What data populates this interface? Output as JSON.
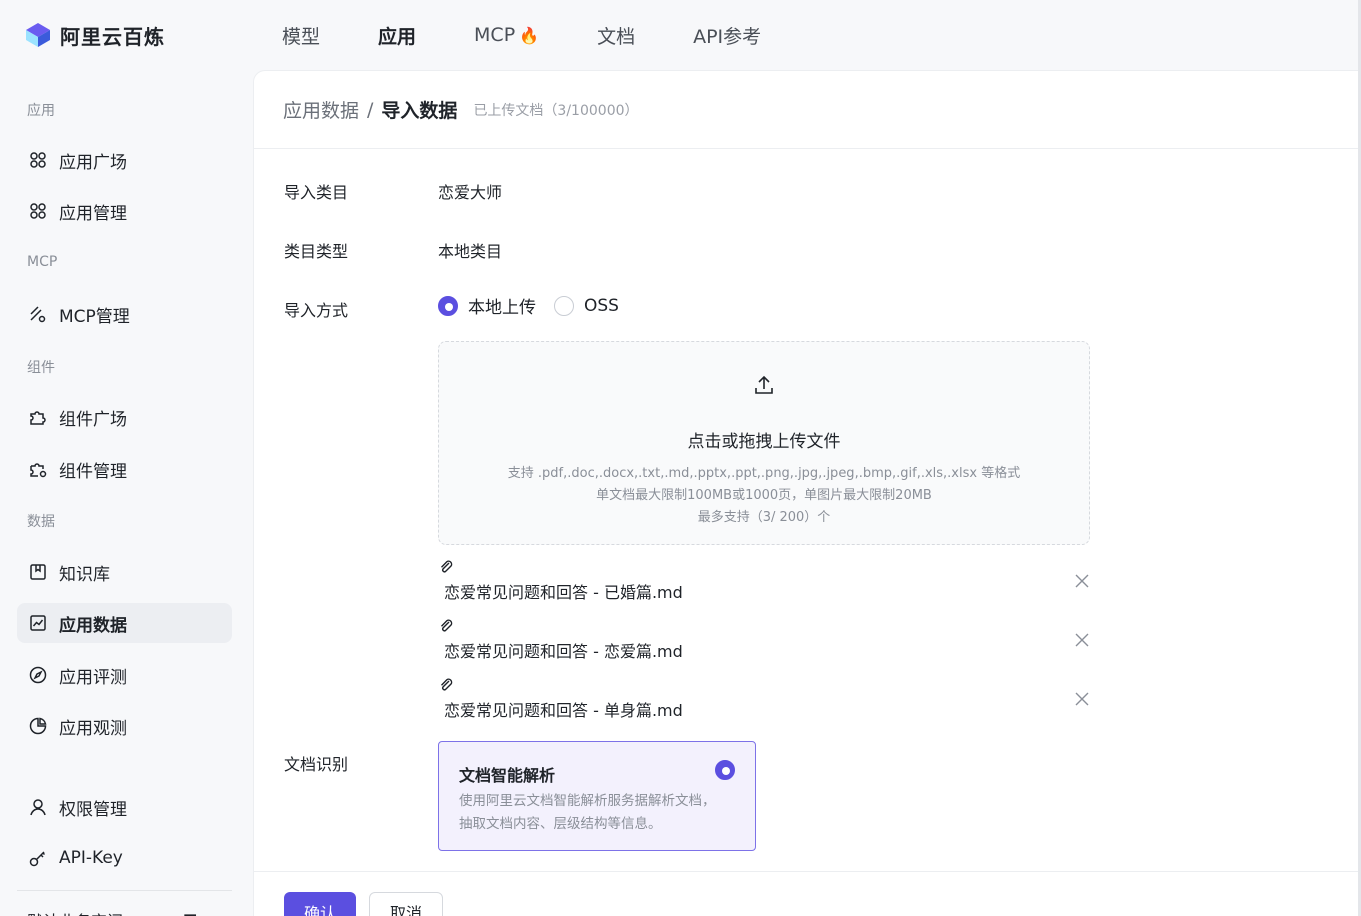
{
  "brand": {
    "name": "阿里云百炼"
  },
  "topnav": [
    {
      "label": "模型"
    },
    {
      "label": "应用"
    },
    {
      "label": "MCP"
    },
    {
      "label": "文档"
    },
    {
      "label": "API参考"
    }
  ],
  "sidebar": {
    "sections": [
      "应用",
      "MCP",
      "组件",
      "数据"
    ],
    "items": [
      {
        "label": "应用广场",
        "icon": "app-grid-icon"
      },
      {
        "label": "应用管理",
        "icon": "app-grid-icon"
      },
      {
        "label": "MCP管理",
        "icon": "mcp-icon"
      },
      {
        "label": "组件广场",
        "icon": "puzzle-icon"
      },
      {
        "label": "组件管理",
        "icon": "puzzle-gear-icon"
      },
      {
        "label": "知识库",
        "icon": "bookmark-icon"
      },
      {
        "label": "应用数据",
        "icon": "chart-line-icon"
      },
      {
        "label": "应用评测",
        "icon": "compass-icon"
      },
      {
        "label": "应用观测",
        "icon": "pie-icon"
      },
      {
        "label": "权限管理",
        "icon": "user-icon"
      },
      {
        "label": "API-Key",
        "icon": "key-icon"
      }
    ],
    "bottom_label": "默认业务空间"
  },
  "header": {
    "crumb_parent": "应用数据",
    "crumb_separator": "/",
    "crumb_current": "导入数据",
    "note": "已上传文档（3/100000）"
  },
  "form": {
    "category_label": "导入类目",
    "category_value": "恋爱大师",
    "type_label": "类目类型",
    "type_value": "本地类目",
    "method_label": "导入方式",
    "method_options": [
      "本地上传",
      "OSS"
    ],
    "method_selected": "本地上传",
    "recognize_label": "文档识别"
  },
  "upload": {
    "title": "点击或拖拽上传文件",
    "formats": "支持 .pdf,.doc,.docx,.txt,.md,.pptx,.ppt,.png,.jpg,.jpeg,.bmp,.gif,.xls,.xlsx 等格式",
    "limit": "单文档最大限制100MB或1000页，单图片最大限制20MB",
    "count": "最多支持（3/ 200）个"
  },
  "files": [
    {
      "name": "恋爱常见问题和回答 - 已婚篇.md"
    },
    {
      "name": "恋爱常见问题和回答 - 恋爱篇.md"
    },
    {
      "name": "恋爱常见问题和回答 - 单身篇.md"
    }
  ],
  "option": {
    "title": "文档智能解析",
    "desc": "使用阿里云文档智能解析服务据解析文档，抽取文档内容、层级结构等信息。"
  },
  "actions": {
    "confirm": "确认",
    "cancel": "取消"
  },
  "colors": {
    "accent": "#5b4fe0",
    "accent_light": "#f3f1fd"
  }
}
